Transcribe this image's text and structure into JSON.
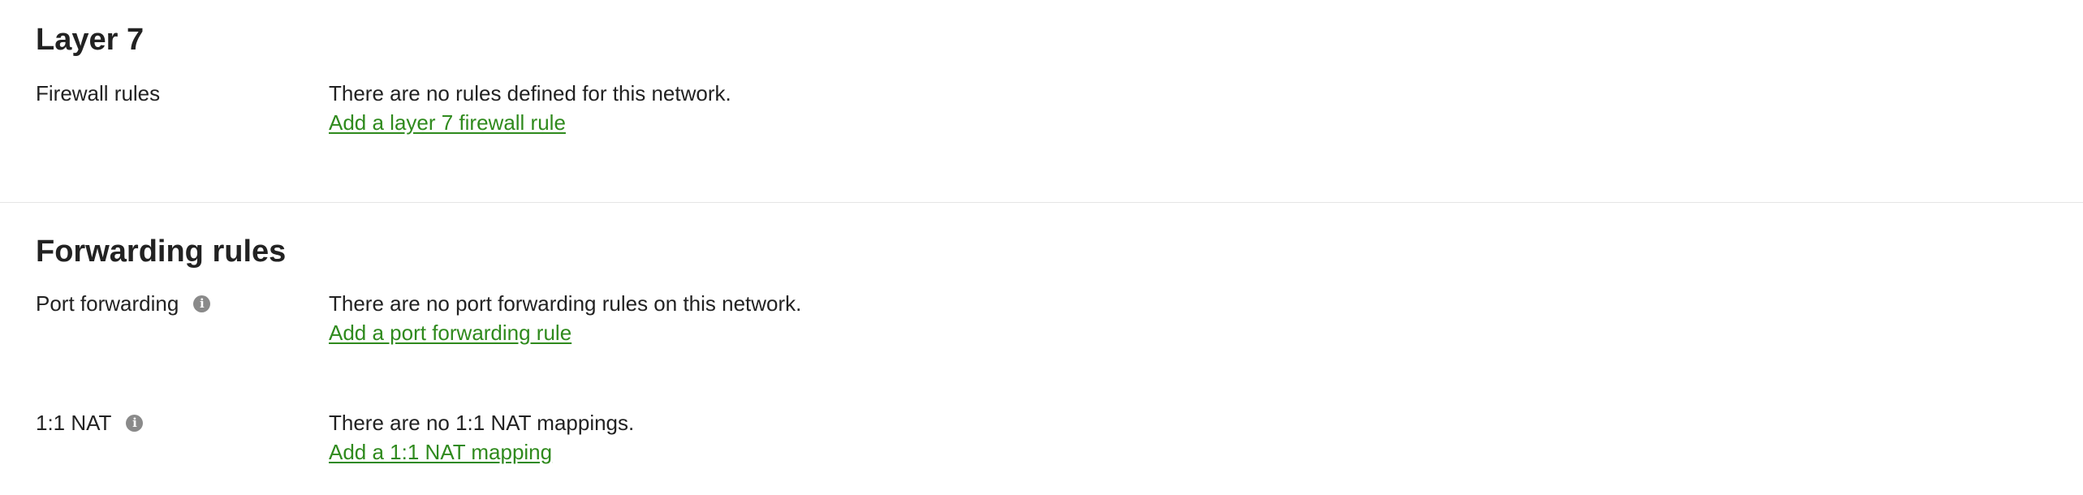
{
  "layer7": {
    "title": "Layer 7",
    "firewall": {
      "label": "Firewall rules",
      "empty_text": "There are no rules defined for this network.",
      "add_link": "Add a layer 7 firewall rule"
    }
  },
  "forwarding": {
    "title": "Forwarding rules",
    "port_forwarding": {
      "label": "Port forwarding",
      "info_icon": "info-icon",
      "empty_text": "There are no port forwarding rules on this network.",
      "add_link": "Add a port forwarding rule"
    },
    "nat": {
      "label": "1:1 NAT",
      "info_icon": "info-icon",
      "empty_text": "There are no 1:1 NAT mappings.",
      "add_link": "Add a 1:1 NAT mapping"
    }
  },
  "colors": {
    "link": "#2f8a1d",
    "text": "#222222",
    "icon": "#8a8a8a",
    "divider": "#e5e5e5"
  }
}
